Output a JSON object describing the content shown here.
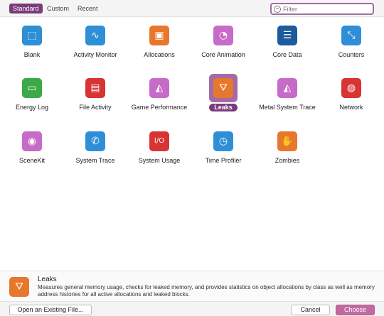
{
  "tabs": [
    {
      "label": "Standard",
      "active": true
    },
    {
      "label": "Custom",
      "active": false
    },
    {
      "label": "Recent",
      "active": false
    }
  ],
  "filter": {
    "placeholder": "Filter"
  },
  "templates": [
    {
      "label": "Blank",
      "icon": "blank-icon",
      "color": "#2e8fd6",
      "glyph": "⬚"
    },
    {
      "label": "Activity Monitor",
      "icon": "activity-monitor-icon",
      "color": "#2e8fd6",
      "glyph": "∿"
    },
    {
      "label": "Allocations",
      "icon": "allocations-icon",
      "color": "#e8772e",
      "glyph": "▣"
    },
    {
      "label": "Core Animation",
      "icon": "core-animation-icon",
      "color": "#c66bc8",
      "glyph": "◔"
    },
    {
      "label": "Core Data",
      "icon": "core-data-icon",
      "color": "#1d5b9c",
      "glyph": "☰"
    },
    {
      "label": "Counters",
      "icon": "counters-icon",
      "color": "#2e8fd6",
      "glyph": "⤡"
    },
    {
      "label": "Energy Log",
      "icon": "energy-log-icon",
      "color": "#3aa946",
      "glyph": "▭"
    },
    {
      "label": "File Activity",
      "icon": "file-activity-icon",
      "color": "#d93434",
      "glyph": "▤"
    },
    {
      "label": "Game Performance",
      "icon": "game-performance-icon",
      "color": "#c66bc8",
      "glyph": "◭"
    },
    {
      "label": "Leaks",
      "icon": "leaks-icon",
      "color": "#e8772e",
      "glyph": "⛛",
      "selected": true
    },
    {
      "label": "Metal System Trace",
      "icon": "metal-system-trace-icon",
      "color": "#c66bc8",
      "glyph": "◭"
    },
    {
      "label": "Network",
      "icon": "network-icon",
      "color": "#d93434",
      "glyph": "◍"
    },
    {
      "label": "SceneKit",
      "icon": "scenekit-icon",
      "color": "#c66bc8",
      "glyph": "◉"
    },
    {
      "label": "System Trace",
      "icon": "system-trace-icon",
      "color": "#2e8fd6",
      "glyph": "✆"
    },
    {
      "label": "System Usage",
      "icon": "system-usage-icon",
      "color": "#d93434",
      "glyph": "I/O"
    },
    {
      "label": "Time Profiler",
      "icon": "time-profiler-icon",
      "color": "#2e8fd6",
      "glyph": "◷"
    },
    {
      "label": "Zombies",
      "icon": "zombies-icon",
      "color": "#e8772e",
      "glyph": "✋"
    }
  ],
  "description": {
    "title": "Leaks",
    "icon": "leaks-icon",
    "text": "Measures general memory usage, checks for leaked memory, and provides statistics on object allocations by class as well as memory address histories for all active allocations and leaked blocks."
  },
  "buttons": {
    "open_existing": "Open an Existing File...",
    "cancel": "Cancel",
    "choose": "Choose"
  }
}
